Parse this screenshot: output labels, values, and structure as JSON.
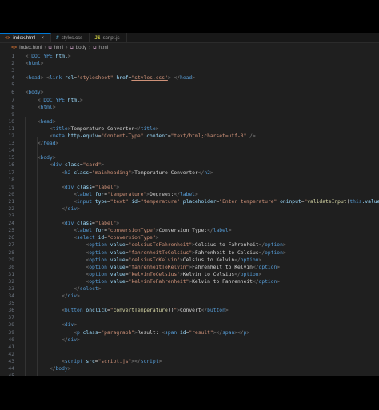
{
  "tabs": [
    {
      "label": "index.html",
      "icon": "html-file-icon",
      "active": true
    },
    {
      "label": "styles.css",
      "icon": "css-file-icon",
      "active": false
    },
    {
      "label": "script.js",
      "icon": "js-file-icon",
      "active": false
    }
  ],
  "breadcrumb": [
    "index.html",
    "html",
    "body",
    "html"
  ],
  "colors": {
    "background": "#1f1f1f",
    "tag": "#569cd6",
    "attribute": "#9cdcfe",
    "string": "#ce9178",
    "text": "#d4d4d4"
  },
  "lines": [
    {
      "n": "1",
      "segs": [
        [
          "  ",
          "tx"
        ],
        [
          "<!",
          "t"
        ],
        [
          "DOCTYPE",
          "tg"
        ],
        [
          " html",
          "at"
        ],
        [
          ">",
          "t"
        ]
      ]
    },
    {
      "n": "2",
      "segs": [
        [
          "  ",
          "tx"
        ],
        [
          "<",
          "t"
        ],
        [
          "html",
          "tg"
        ],
        [
          ">",
          "t"
        ]
      ]
    },
    {
      "n": "3",
      "segs": []
    },
    {
      "n": "4",
      "segs": [
        [
          "  ",
          "tx"
        ],
        [
          "<",
          "t"
        ],
        [
          "head",
          "tg"
        ],
        [
          ">",
          "t"
        ],
        [
          " ",
          "tx"
        ],
        [
          "<",
          "t"
        ],
        [
          "link",
          "tg"
        ],
        [
          " rel",
          "at"
        ],
        [
          "=",
          "tx"
        ],
        [
          "\"stylesheet\"",
          "st"
        ],
        [
          " href",
          "at"
        ],
        [
          "=",
          "tx"
        ],
        [
          "\"styles.css\"",
          "st ul"
        ],
        [
          ">",
          "t"
        ],
        [
          " ",
          "tx"
        ],
        [
          "</",
          "t"
        ],
        [
          "head",
          "tg"
        ],
        [
          ">",
          "t"
        ]
      ]
    },
    {
      "n": "5",
      "segs": []
    },
    {
      "n": "6",
      "segs": [
        [
          "  ",
          "tx"
        ],
        [
          "<",
          "t"
        ],
        [
          "body",
          "tg"
        ],
        [
          ">",
          "t"
        ]
      ]
    },
    {
      "n": "7",
      "segs": [
        [
          "      ",
          "tx"
        ],
        [
          "<!",
          "t"
        ],
        [
          "DOCTYPE",
          "tg"
        ],
        [
          " html",
          "at"
        ],
        [
          ">",
          "t"
        ]
      ]
    },
    {
      "n": "8",
      "segs": [
        [
          "      ",
          "tx"
        ],
        [
          "<",
          "t"
        ],
        [
          "html",
          "tg"
        ],
        [
          ">",
          "t"
        ]
      ]
    },
    {
      "n": "9",
      "segs": []
    },
    {
      "n": "10",
      "segs": [
        [
          "      ",
          "tx"
        ],
        [
          "<",
          "t"
        ],
        [
          "head",
          "tg"
        ],
        [
          ">",
          "t"
        ]
      ]
    },
    {
      "n": "11",
      "segs": [
        [
          "          ",
          "tx"
        ],
        [
          "<",
          "t"
        ],
        [
          "title",
          "tg"
        ],
        [
          ">",
          "t"
        ],
        [
          "Temperature Converter",
          "tx"
        ],
        [
          "</",
          "t"
        ],
        [
          "title",
          "tg"
        ],
        [
          ">",
          "t"
        ]
      ]
    },
    {
      "n": "12",
      "segs": [
        [
          "          ",
          "tx"
        ],
        [
          "<",
          "t"
        ],
        [
          "meta",
          "tg"
        ],
        [
          " http-equiv",
          "at"
        ],
        [
          "=",
          "tx"
        ],
        [
          "\"Content-Type\"",
          "st"
        ],
        [
          " content",
          "at"
        ],
        [
          "=",
          "tx"
        ],
        [
          "\"text/html;charset=utf-8\"",
          "st"
        ],
        [
          " />",
          "t"
        ]
      ]
    },
    {
      "n": "13",
      "segs": [
        [
          "      ",
          "tx"
        ],
        [
          "</",
          "t"
        ],
        [
          "head",
          "tg"
        ],
        [
          ">",
          "t"
        ]
      ]
    },
    {
      "n": "14",
      "segs": []
    },
    {
      "n": "15",
      "segs": [
        [
          "      ",
          "tx"
        ],
        [
          "<",
          "t"
        ],
        [
          "body",
          "tg"
        ],
        [
          ">",
          "t"
        ]
      ]
    },
    {
      "n": "16",
      "segs": [
        [
          "          ",
          "tx"
        ],
        [
          "<",
          "t"
        ],
        [
          "div",
          "tg"
        ],
        [
          " class",
          "at"
        ],
        [
          "=",
          "tx"
        ],
        [
          "\"card\"",
          "st"
        ],
        [
          ">",
          "t"
        ]
      ]
    },
    {
      "n": "17",
      "segs": [
        [
          "              ",
          "tx"
        ],
        [
          "<",
          "t"
        ],
        [
          "h2",
          "tg"
        ],
        [
          " class",
          "at"
        ],
        [
          "=",
          "tx"
        ],
        [
          "\"mainheading\"",
          "st"
        ],
        [
          ">",
          "t"
        ],
        [
          "Temperature Converter",
          "tx"
        ],
        [
          "</",
          "t"
        ],
        [
          "h2",
          "tg"
        ],
        [
          ">",
          "t"
        ]
      ]
    },
    {
      "n": "18",
      "segs": []
    },
    {
      "n": "19",
      "segs": [
        [
          "              ",
          "tx"
        ],
        [
          "<",
          "t"
        ],
        [
          "div",
          "tg"
        ],
        [
          " class",
          "at"
        ],
        [
          "=",
          "tx"
        ],
        [
          "\"label\"",
          "st"
        ],
        [
          ">",
          "t"
        ]
      ]
    },
    {
      "n": "20",
      "segs": [
        [
          "                  ",
          "tx"
        ],
        [
          "<",
          "t"
        ],
        [
          "label",
          "tg"
        ],
        [
          " for",
          "at"
        ],
        [
          "=",
          "tx"
        ],
        [
          "\"temperature\"",
          "st"
        ],
        [
          ">",
          "t"
        ],
        [
          "Degrees:",
          "tx"
        ],
        [
          "</",
          "t"
        ],
        [
          "label",
          "tg"
        ],
        [
          ">",
          "t"
        ]
      ]
    },
    {
      "n": "21",
      "segs": [
        [
          "                  ",
          "tx"
        ],
        [
          "<",
          "t"
        ],
        [
          "input",
          "tg"
        ],
        [
          " type",
          "at"
        ],
        [
          "=",
          "tx"
        ],
        [
          "\"text\"",
          "st"
        ],
        [
          " id",
          "at"
        ],
        [
          "=",
          "tx"
        ],
        [
          "\"temperature\"",
          "st"
        ],
        [
          " placeholder",
          "at"
        ],
        [
          "=",
          "tx"
        ],
        [
          "\"Enter temperature\"",
          "st"
        ],
        [
          " oninput",
          "at"
        ],
        [
          "=",
          "tx"
        ],
        [
          "\"",
          "st"
        ],
        [
          "validateInput",
          "fn"
        ],
        [
          "(",
          "tx"
        ],
        [
          "this",
          "kw"
        ],
        [
          ".value",
          "at"
        ],
        [
          ")",
          "tx"
        ],
        [
          "\"",
          "st"
        ],
        [
          ">",
          "t"
        ]
      ]
    },
    {
      "n": "22",
      "segs": [
        [
          "              ",
          "tx"
        ],
        [
          "</",
          "t"
        ],
        [
          "div",
          "tg"
        ],
        [
          ">",
          "t"
        ]
      ]
    },
    {
      "n": "23",
      "segs": []
    },
    {
      "n": "24",
      "segs": [
        [
          "              ",
          "tx"
        ],
        [
          "<",
          "t"
        ],
        [
          "div",
          "tg"
        ],
        [
          " class",
          "at"
        ],
        [
          "=",
          "tx"
        ],
        [
          "\"label\"",
          "st"
        ],
        [
          ">",
          "t"
        ]
      ]
    },
    {
      "n": "25",
      "segs": [
        [
          "                  ",
          "tx"
        ],
        [
          "<",
          "t"
        ],
        [
          "label",
          "tg"
        ],
        [
          " for",
          "at"
        ],
        [
          "=",
          "tx"
        ],
        [
          "\"conversionType\"",
          "st"
        ],
        [
          ">",
          "t"
        ],
        [
          "Conversion Type:",
          "tx"
        ],
        [
          "</",
          "t"
        ],
        [
          "label",
          "tg"
        ],
        [
          ">",
          "t"
        ]
      ]
    },
    {
      "n": "26",
      "segs": [
        [
          "                  ",
          "tx"
        ],
        [
          "<",
          "t"
        ],
        [
          "select",
          "tg"
        ],
        [
          " id",
          "at"
        ],
        [
          "=",
          "tx"
        ],
        [
          "\"conversionType\"",
          "st"
        ],
        [
          ">",
          "t"
        ]
      ]
    },
    {
      "n": "27",
      "segs": [
        [
          "                      ",
          "tx"
        ],
        [
          "<",
          "t"
        ],
        [
          "option",
          "tg"
        ],
        [
          " value",
          "at"
        ],
        [
          "=",
          "tx"
        ],
        [
          "\"celsiusToFahrenheit\"",
          "st"
        ],
        [
          ">",
          "t"
        ],
        [
          "Celsius to Fahrenheit",
          "tx"
        ],
        [
          "</",
          "t"
        ],
        [
          "option",
          "tg"
        ],
        [
          ">",
          "t"
        ]
      ]
    },
    {
      "n": "28",
      "segs": [
        [
          "                      ",
          "tx"
        ],
        [
          "<",
          "t"
        ],
        [
          "option",
          "tg"
        ],
        [
          " value",
          "at"
        ],
        [
          "=",
          "tx"
        ],
        [
          "\"fahrenheitToCelsius\"",
          "st"
        ],
        [
          ">",
          "t"
        ],
        [
          "Fahrenheit to Celsius",
          "tx"
        ],
        [
          "</",
          "t"
        ],
        [
          "option",
          "tg"
        ],
        [
          ">",
          "t"
        ]
      ]
    },
    {
      "n": "29",
      "segs": [
        [
          "                      ",
          "tx"
        ],
        [
          "<",
          "t"
        ],
        [
          "option",
          "tg"
        ],
        [
          " value",
          "at"
        ],
        [
          "=",
          "tx"
        ],
        [
          "\"celsiusToKelvin\"",
          "st"
        ],
        [
          ">",
          "t"
        ],
        [
          "Celsius to Kelvin",
          "tx"
        ],
        [
          "</",
          "t"
        ],
        [
          "option",
          "tg"
        ],
        [
          ">",
          "t"
        ]
      ]
    },
    {
      "n": "30",
      "segs": [
        [
          "                      ",
          "tx"
        ],
        [
          "<",
          "t"
        ],
        [
          "option",
          "tg"
        ],
        [
          " value",
          "at"
        ],
        [
          "=",
          "tx"
        ],
        [
          "\"fahrenheitToKelvin\"",
          "st"
        ],
        [
          ">",
          "t"
        ],
        [
          "Fahrenheit to Kelvin",
          "tx"
        ],
        [
          "</",
          "t"
        ],
        [
          "option",
          "tg"
        ],
        [
          ">",
          "t"
        ]
      ]
    },
    {
      "n": "31",
      "segs": [
        [
          "                      ",
          "tx"
        ],
        [
          "<",
          "t"
        ],
        [
          "option",
          "tg"
        ],
        [
          " value",
          "at"
        ],
        [
          "=",
          "tx"
        ],
        [
          "\"kelvinToCelsius\"",
          "st"
        ],
        [
          ">",
          "t"
        ],
        [
          "Kelvin to Celsius",
          "tx"
        ],
        [
          "</",
          "t"
        ],
        [
          "option",
          "tg"
        ],
        [
          ">",
          "t"
        ]
      ]
    },
    {
      "n": "32",
      "segs": [
        [
          "                      ",
          "tx"
        ],
        [
          "<",
          "t"
        ],
        [
          "option",
          "tg"
        ],
        [
          " value",
          "at"
        ],
        [
          "=",
          "tx"
        ],
        [
          "\"kelvinToFahrenheit\"",
          "st"
        ],
        [
          ">",
          "t"
        ],
        [
          "Kelvin to Fahrenheit",
          "tx"
        ],
        [
          "</",
          "t"
        ],
        [
          "option",
          "tg"
        ],
        [
          ">",
          "t"
        ]
      ]
    },
    {
      "n": "33",
      "segs": [
        [
          "                  ",
          "tx"
        ],
        [
          "</",
          "t"
        ],
        [
          "select",
          "tg"
        ],
        [
          ">",
          "t"
        ]
      ]
    },
    {
      "n": "34",
      "segs": [
        [
          "              ",
          "tx"
        ],
        [
          "</",
          "t"
        ],
        [
          "div",
          "tg"
        ],
        [
          ">",
          "t"
        ]
      ]
    },
    {
      "n": "35",
      "segs": []
    },
    {
      "n": "36",
      "segs": [
        [
          "              ",
          "tx"
        ],
        [
          "<",
          "t"
        ],
        [
          "button",
          "tg"
        ],
        [
          " onclick",
          "at"
        ],
        [
          "=",
          "tx"
        ],
        [
          "\"",
          "st"
        ],
        [
          "convertTemperature",
          "fn"
        ],
        [
          "()",
          "tx"
        ],
        [
          "\"",
          "st"
        ],
        [
          ">",
          "t"
        ],
        [
          "Convert",
          "tx"
        ],
        [
          "</",
          "t"
        ],
        [
          "button",
          "tg"
        ],
        [
          ">",
          "t"
        ]
      ]
    },
    {
      "n": "37",
      "segs": []
    },
    {
      "n": "38",
      "segs": [
        [
          "              ",
          "tx"
        ],
        [
          "<",
          "t"
        ],
        [
          "div",
          "tg"
        ],
        [
          ">",
          "t"
        ]
      ]
    },
    {
      "n": "39",
      "segs": [
        [
          "                  ",
          "tx"
        ],
        [
          "<",
          "t"
        ],
        [
          "p",
          "tg"
        ],
        [
          " class",
          "at"
        ],
        [
          "=",
          "tx"
        ],
        [
          "\"paragraph\"",
          "st"
        ],
        [
          ">",
          "t"
        ],
        [
          "Result: ",
          "tx"
        ],
        [
          "<",
          "t"
        ],
        [
          "span",
          "tg"
        ],
        [
          " id",
          "at"
        ],
        [
          "=",
          "tx"
        ],
        [
          "\"result\"",
          "st"
        ],
        [
          ">",
          "t"
        ],
        [
          "</",
          "t"
        ],
        [
          "span",
          "tg"
        ],
        [
          ">",
          "t"
        ],
        [
          "</",
          "t"
        ],
        [
          "p",
          "tg"
        ],
        [
          ">",
          "t"
        ]
      ]
    },
    {
      "n": "40",
      "segs": [
        [
          "              ",
          "tx"
        ],
        [
          "</",
          "t"
        ],
        [
          "div",
          "tg"
        ],
        [
          ">",
          "t"
        ]
      ]
    },
    {
      "n": "41",
      "segs": []
    },
    {
      "n": "42",
      "segs": []
    },
    {
      "n": "43",
      "segs": [
        [
          "              ",
          "tx"
        ],
        [
          "<",
          "t"
        ],
        [
          "script",
          "tg"
        ],
        [
          " src",
          "at"
        ],
        [
          "=",
          "tx"
        ],
        [
          "\"script.js\"",
          "st ul"
        ],
        [
          ">",
          "t"
        ],
        [
          "</",
          "t"
        ],
        [
          "script",
          "tg"
        ],
        [
          ">",
          "t"
        ]
      ]
    },
    {
      "n": "44",
      "segs": [
        [
          "          ",
          "tx"
        ],
        [
          "</",
          "t"
        ],
        [
          "body",
          "tg"
        ],
        [
          ">",
          "t"
        ]
      ]
    },
    {
      "n": "45",
      "segs": []
    }
  ]
}
